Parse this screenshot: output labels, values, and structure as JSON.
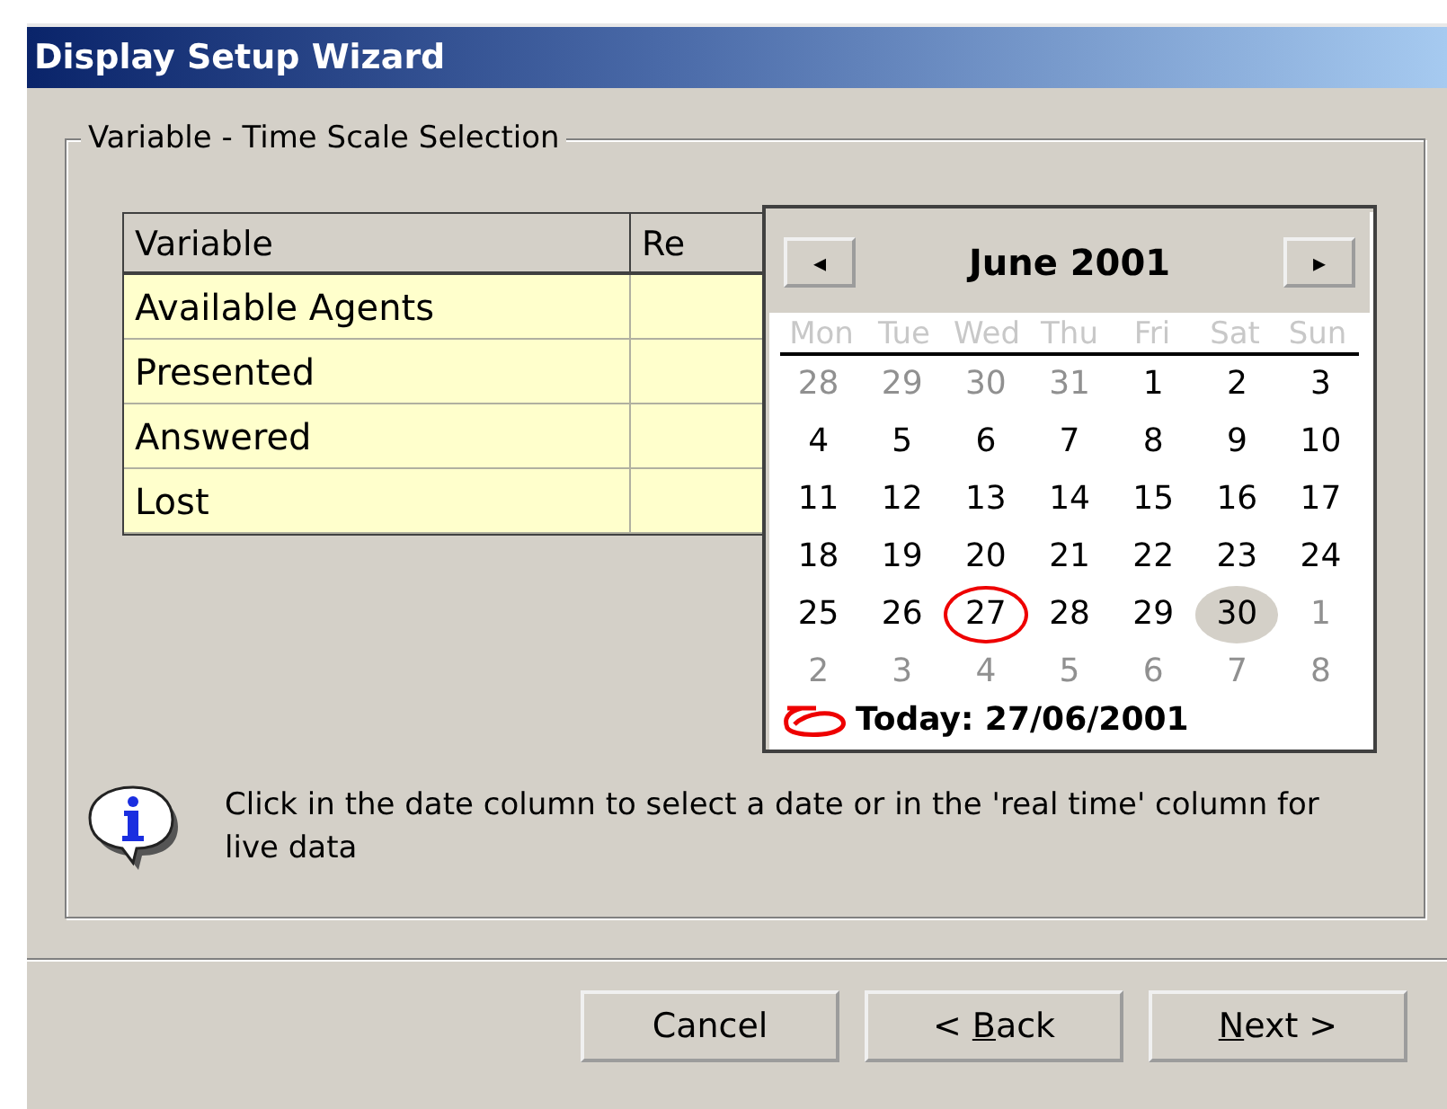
{
  "window": {
    "title": "Display Setup Wizard"
  },
  "group": {
    "title": "Variable - Time Scale Selection"
  },
  "table": {
    "columns": [
      "Variable",
      "Re"
    ],
    "rows": [
      {
        "variable": "Available Agents"
      },
      {
        "variable": "Presented"
      },
      {
        "variable": "Answered"
      },
      {
        "variable": "Lost"
      }
    ]
  },
  "calendar": {
    "prev": "◂",
    "next": "▸",
    "month": "June 2001",
    "weekdays": [
      "Mon",
      "Tue",
      "Wed",
      "Thu",
      "Fri",
      "Sat",
      "Sun"
    ],
    "weeks": [
      [
        {
          "day": "28",
          "other_month": true,
          "selected": false,
          "today": false
        },
        {
          "day": "29",
          "other_month": true,
          "selected": false,
          "today": false
        },
        {
          "day": "30",
          "other_month": true,
          "selected": false,
          "today": false
        },
        {
          "day": "31",
          "other_month": true,
          "selected": false,
          "today": false
        },
        {
          "day": "1",
          "other_month": false,
          "selected": false,
          "today": false
        },
        {
          "day": "2",
          "other_month": false,
          "selected": false,
          "today": false
        },
        {
          "day": "3",
          "other_month": false,
          "selected": false,
          "today": false
        }
      ],
      [
        {
          "day": "4",
          "other_month": false,
          "selected": false,
          "today": false
        },
        {
          "day": "5",
          "other_month": false,
          "selected": false,
          "today": false
        },
        {
          "day": "6",
          "other_month": false,
          "selected": false,
          "today": false
        },
        {
          "day": "7",
          "other_month": false,
          "selected": false,
          "today": false
        },
        {
          "day": "8",
          "other_month": false,
          "selected": false,
          "today": false
        },
        {
          "day": "9",
          "other_month": false,
          "selected": false,
          "today": false
        },
        {
          "day": "10",
          "other_month": false,
          "selected": false,
          "today": false
        }
      ],
      [
        {
          "day": "11",
          "other_month": false,
          "selected": false,
          "today": false
        },
        {
          "day": "12",
          "other_month": false,
          "selected": false,
          "today": false
        },
        {
          "day": "13",
          "other_month": false,
          "selected": false,
          "today": false
        },
        {
          "day": "14",
          "other_month": false,
          "selected": false,
          "today": false
        },
        {
          "day": "15",
          "other_month": false,
          "selected": false,
          "today": false
        },
        {
          "day": "16",
          "other_month": false,
          "selected": false,
          "today": false
        },
        {
          "day": "17",
          "other_month": false,
          "selected": false,
          "today": false
        }
      ],
      [
        {
          "day": "18",
          "other_month": false,
          "selected": false,
          "today": false
        },
        {
          "day": "19",
          "other_month": false,
          "selected": false,
          "today": false
        },
        {
          "day": "20",
          "other_month": false,
          "selected": false,
          "today": false
        },
        {
          "day": "21",
          "other_month": false,
          "selected": false,
          "today": false
        },
        {
          "day": "22",
          "other_month": false,
          "selected": false,
          "today": false
        },
        {
          "day": "23",
          "other_month": false,
          "selected": false,
          "today": false
        },
        {
          "day": "24",
          "other_month": false,
          "selected": false,
          "today": false
        }
      ],
      [
        {
          "day": "25",
          "other_month": false,
          "selected": false,
          "today": false
        },
        {
          "day": "26",
          "other_month": false,
          "selected": false,
          "today": false
        },
        {
          "day": "27",
          "other_month": false,
          "selected": false,
          "today": true
        },
        {
          "day": "28",
          "other_month": false,
          "selected": false,
          "today": false
        },
        {
          "day": "29",
          "other_month": false,
          "selected": false,
          "today": false
        },
        {
          "day": "30",
          "other_month": false,
          "selected": true,
          "today": false
        },
        {
          "day": "1",
          "other_month": true,
          "selected": false,
          "today": false
        }
      ],
      [
        {
          "day": "2",
          "other_month": true,
          "selected": false,
          "today": false
        },
        {
          "day": "3",
          "other_month": true,
          "selected": false,
          "today": false
        },
        {
          "day": "4",
          "other_month": true,
          "selected": false,
          "today": false
        },
        {
          "day": "5",
          "other_month": true,
          "selected": false,
          "today": false
        },
        {
          "day": "6",
          "other_month": true,
          "selected": false,
          "today": false
        },
        {
          "day": "7",
          "other_month": true,
          "selected": false,
          "today": false
        },
        {
          "day": "8",
          "other_month": true,
          "selected": false,
          "today": false
        }
      ]
    ],
    "today_label": "Today: 27/06/2001"
  },
  "info": {
    "text": "Click in the date column to select a date or in the 'real time' column for live data"
  },
  "buttons": [
    {
      "parts": [
        {
          "text": "Cancel",
          "underlined": false
        }
      ]
    },
    {
      "parts": [
        {
          "text": "< ",
          "underlined": false
        },
        {
          "text": "B",
          "underlined": true
        },
        {
          "text": "ack",
          "underlined": false
        }
      ]
    },
    {
      "parts": [
        {
          "text": "N",
          "underlined": true
        },
        {
          "text": "ext >",
          "underlined": false
        }
      ]
    }
  ]
}
